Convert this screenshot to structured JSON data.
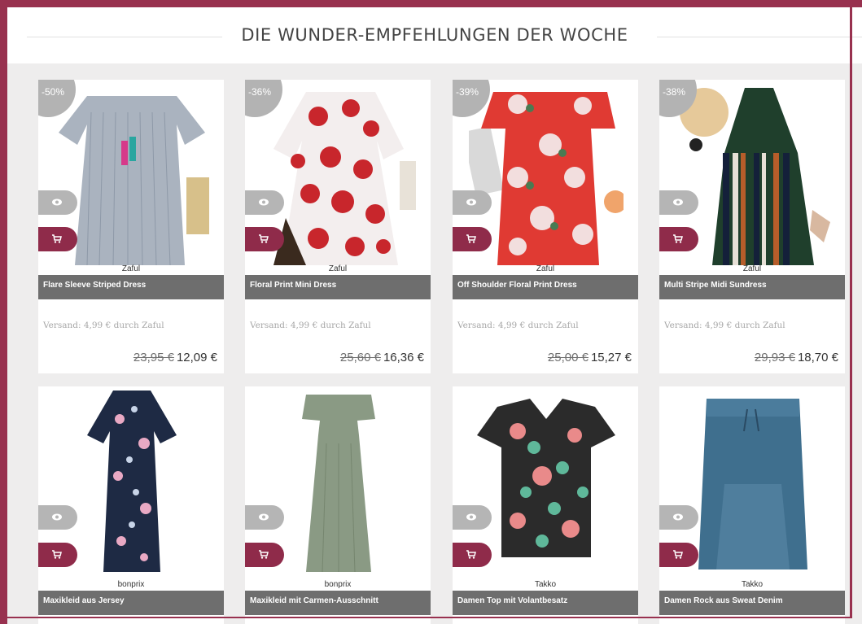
{
  "section_title": "DIE WUNDER-EMPFEHLUNGEN DER WOCHE",
  "products": [
    {
      "discount": "-50%",
      "brand": "Zaful",
      "name": "Flare Sleeve Striped Dress",
      "shipping": "Versand: 4,99 € durch Zaful",
      "old_price": "23,95 €",
      "price": "12,09 €"
    },
    {
      "discount": "-36%",
      "brand": "Zaful",
      "name": "Floral Print Mini Dress",
      "shipping": "Versand: 4,99 € durch Zaful",
      "old_price": "25,60 €",
      "price": "16,36 €"
    },
    {
      "discount": "-39%",
      "brand": "Zaful",
      "name": "Off Shoulder Floral Print Dress",
      "shipping": "Versand: 4,99 € durch Zaful",
      "old_price": "25,00 €",
      "price": "15,27 €"
    },
    {
      "discount": "-38%",
      "brand": "Zaful",
      "name": "Multi Stripe Midi Sundress",
      "shipping": "Versand: 4,99 € durch Zaful",
      "old_price": "29,93 €",
      "price": "18,70 €"
    },
    {
      "brand": "bonprix",
      "name": "Maxikleid aus Jersey"
    },
    {
      "brand": "bonprix",
      "name": "Maxikleid mit Carmen-Ausschnitt"
    },
    {
      "brand": "Takko",
      "name": "Damen Top mit Volantbesatz"
    },
    {
      "brand": "Takko",
      "name": "Damen Rock aus Sweat Denim"
    }
  ],
  "icons": {
    "quick_view": "eye-icon",
    "add_to_cart": "cart-icon"
  },
  "colors": {
    "accent": "#98314f",
    "cart_button": "#8f2b4a",
    "name_bar": "#6e6e6e",
    "background": "#eeeded"
  }
}
